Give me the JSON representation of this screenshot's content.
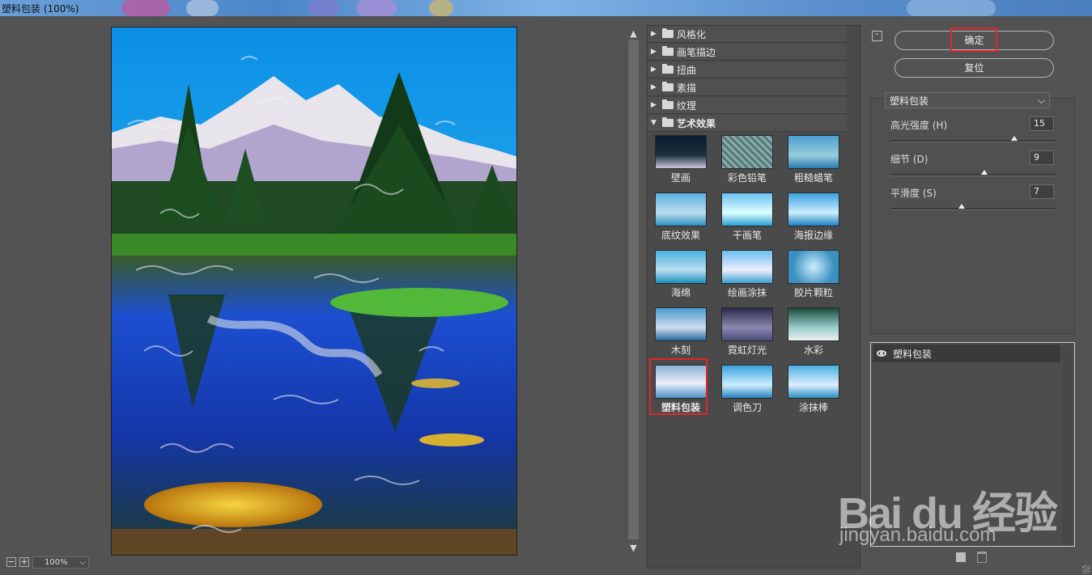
{
  "window": {
    "title": "塑料包装 (100%)"
  },
  "preview": {
    "zoom": "100%",
    "zoom_minus": "−",
    "zoom_plus": "+",
    "zoom_menu": "⌵"
  },
  "gallery": {
    "categories": [
      {
        "label": "风格化",
        "expanded": false
      },
      {
        "label": "画笔描边",
        "expanded": false
      },
      {
        "label": "扭曲",
        "expanded": false
      },
      {
        "label": "素描",
        "expanded": false
      },
      {
        "label": "纹理",
        "expanded": false
      },
      {
        "label": "艺术效果",
        "expanded": true
      }
    ],
    "filters": [
      "壁画",
      "彩色铅笔",
      "粗糙蜡笔",
      "底纹效果",
      "干画笔",
      "海报边缘",
      "海绵",
      "绘画涂抹",
      "胶片颗粒",
      "木刻",
      "霓虹灯光",
      "水彩",
      "塑料包装",
      "调色刀",
      "涂抹棒"
    ],
    "selected": "塑料包装"
  },
  "buttons": {
    "ok": "确定",
    "reset": "复位"
  },
  "settings": {
    "filter_name": "塑料包装",
    "params": [
      {
        "label": "高光强度 (H)",
        "value": "15",
        "fraction": 0.75
      },
      {
        "label": "细节 (D)",
        "value": "9",
        "fraction": 0.57
      },
      {
        "label": "平滑度 (S)",
        "value": "7",
        "fraction": 0.43
      }
    ]
  },
  "layers": {
    "items": [
      {
        "name": "塑料包装",
        "visible": true
      }
    ]
  },
  "watermark": {
    "logo": "Bai du 经验",
    "url": "jingyan.baidu.com"
  },
  "colors": {
    "accent_red": "#e2252b",
    "panel": "#535353"
  }
}
